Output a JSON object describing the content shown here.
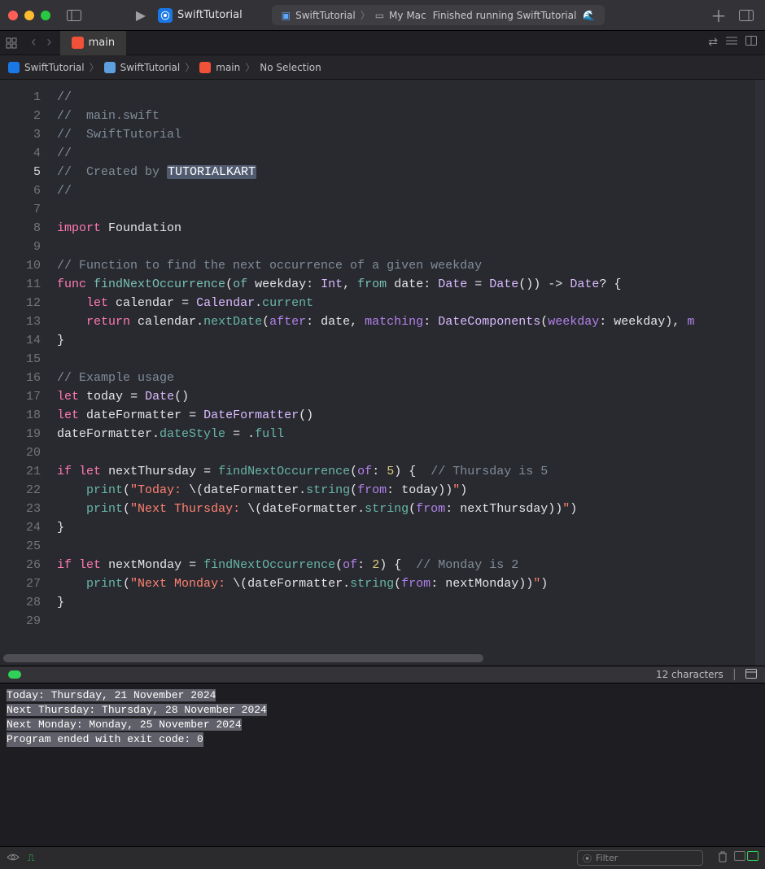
{
  "titlebar": {
    "scheme_name": "SwiftTutorial",
    "pill_project": "SwiftTutorial",
    "pill_destination": "My Mac",
    "pill_status": "Finished running SwiftTutorial"
  },
  "tabs": {
    "file_name": "main"
  },
  "jumpbar": {
    "items": [
      "SwiftTutorial",
      "SwiftTutorial",
      "main",
      "No Selection"
    ]
  },
  "code": {
    "author_highlight": "TUTORIALKART",
    "lines": [
      {
        "n": 1,
        "t": "comment",
        "s": "//"
      },
      {
        "n": 2,
        "t": "comment",
        "s": "//  main.swift"
      },
      {
        "n": 3,
        "t": "comment",
        "s": "//  SwiftTutorial"
      },
      {
        "n": 4,
        "t": "comment",
        "s": "//"
      },
      {
        "n": 5,
        "t": "created"
      },
      {
        "n": 6,
        "t": "comment",
        "s": "//"
      },
      {
        "n": 7,
        "t": "blank"
      },
      {
        "n": 8,
        "t": "import"
      },
      {
        "n": 9,
        "t": "blank"
      },
      {
        "n": 10,
        "t": "comment",
        "s": "// Function to find the next occurrence of a given weekday"
      },
      {
        "n": 11,
        "t": "funcdecl"
      },
      {
        "n": 12,
        "t": "let_calendar"
      },
      {
        "n": 13,
        "t": "return_next"
      },
      {
        "n": 14,
        "t": "brace"
      },
      {
        "n": 15,
        "t": "blank"
      },
      {
        "n": 16,
        "t": "comment",
        "s": "// Example usage"
      },
      {
        "n": 17,
        "t": "let_today"
      },
      {
        "n": 18,
        "t": "let_formatter"
      },
      {
        "n": 19,
        "t": "datestyle"
      },
      {
        "n": 20,
        "t": "blank"
      },
      {
        "n": 21,
        "t": "if_thursday"
      },
      {
        "n": 22,
        "t": "print_today"
      },
      {
        "n": 23,
        "t": "print_next_thursday"
      },
      {
        "n": 24,
        "t": "brace"
      },
      {
        "n": 25,
        "t": "blank"
      },
      {
        "n": 26,
        "t": "if_monday"
      },
      {
        "n": 27,
        "t": "print_next_monday"
      },
      {
        "n": 28,
        "t": "brace"
      },
      {
        "n": 29,
        "t": "blank"
      }
    ]
  },
  "debug": {
    "status_right": "12 characters"
  },
  "console": {
    "lines": [
      "Today: Thursday, 21 November 2024",
      "Next Thursday: Thursday, 28 November 2024",
      "Next Monday: Monday, 25 November 2024",
      "Program ended with exit code: 0"
    ]
  },
  "bottombar": {
    "filter_placeholder": "Filter"
  }
}
